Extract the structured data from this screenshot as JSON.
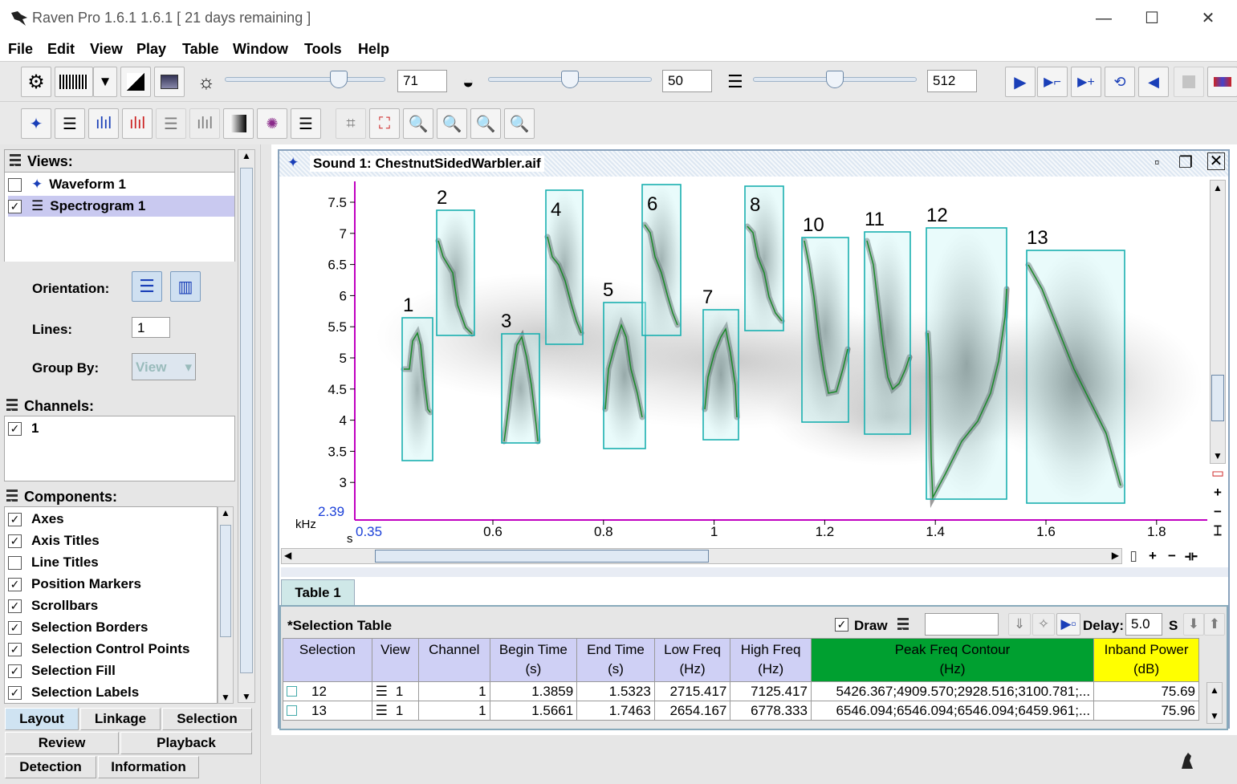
{
  "window": {
    "title": "Raven Pro 1.6.1 1.6.1  [ 21 days remaining ]",
    "minimize": "—",
    "maximize": "☐",
    "close": "✕"
  },
  "menu": [
    "File",
    "Edit",
    "View",
    "Play",
    "Table",
    "Window",
    "Tools",
    "Help"
  ],
  "toolbar": {
    "brightness": "71",
    "contrast": "50",
    "size": "512",
    "brightness_level": 0.71,
    "contrast_level": 0.5,
    "size_level": 0.5
  },
  "sidebar": {
    "views_title": "Views:",
    "views": [
      {
        "label": "Waveform 1",
        "checked": false
      },
      {
        "label": "Spectrogram 1",
        "checked": true
      }
    ],
    "orientation_label": "Orientation:",
    "lines_label": "Lines:",
    "lines_value": "1",
    "groupby_label": "Group By:",
    "groupby_value": "View",
    "channels_title": "Channels:",
    "channels": [
      {
        "label": "1",
        "checked": true
      }
    ],
    "components_title": "Components:",
    "components": [
      {
        "label": "Axes",
        "checked": true
      },
      {
        "label": "Axis Titles",
        "checked": true
      },
      {
        "label": "Line Titles",
        "checked": false
      },
      {
        "label": "Position Markers",
        "checked": true
      },
      {
        "label": "Scrollbars",
        "checked": true
      },
      {
        "label": "Selection Borders",
        "checked": true
      },
      {
        "label": "Selection Control Points",
        "checked": true
      },
      {
        "label": "Selection Fill",
        "checked": true
      },
      {
        "label": "Selection Labels",
        "checked": true
      }
    ],
    "tabs": [
      "Layout",
      "Linkage",
      "Selection",
      "Review",
      "Playback",
      "Detection",
      "Information"
    ]
  },
  "sound": {
    "title": "Sound 1: ChestnutSidedWarbler.aif"
  },
  "spectrogram": {
    "y_unit": "kHz",
    "x_unit": "s",
    "y_ticks": [
      "7.5",
      "7",
      "6.5",
      "6",
      "5.5",
      "5",
      "4.5",
      "4",
      "3.5",
      "3"
    ],
    "y_min_label": "2.39",
    "x_ticks": [
      "0.6",
      "0.8",
      "1",
      "1.2",
      "1.4",
      "1.6",
      "1.8"
    ],
    "x_min_label": "0.35",
    "selection_labels": [
      "1",
      "2",
      "3",
      "4",
      "5",
      "6",
      "7",
      "8",
      "10",
      "11",
      "12",
      "13"
    ]
  },
  "table_tab": "Table 1",
  "table": {
    "title": "*Selection Table",
    "draw_label": "Draw",
    "delay_label": "Delay:",
    "delay_value": "5.0",
    "delay_unit": "S",
    "headers": [
      {
        "a": "Selection",
        "b": ""
      },
      {
        "a": "View",
        "b": ""
      },
      {
        "a": "Channel",
        "b": ""
      },
      {
        "a": "Begin Time",
        "b": "(s)"
      },
      {
        "a": "End Time",
        "b": "(s)"
      },
      {
        "a": "Low Freq",
        "b": "(Hz)"
      },
      {
        "a": "High Freq",
        "b": "(Hz)"
      },
      {
        "a": "Peak Freq Contour",
        "b": "(Hz)"
      },
      {
        "a": "Inband Power",
        "b": "(dB)"
      }
    ],
    "header_colors": {
      "peak": "#00a030",
      "inband": "#ffff00"
    },
    "rows": [
      [
        "12",
        "1",
        "1",
        "1.3859",
        "1.5323",
        "2715.417",
        "7125.417",
        "5426.367;4909.570;2928.516;3100.781;...",
        "75.69"
      ],
      [
        "13",
        "1",
        "1",
        "1.5661",
        "1.7463",
        "2654.167",
        "6778.333",
        "6546.094;6546.094;6546.094;6459.961;...",
        "75.96"
      ]
    ]
  }
}
